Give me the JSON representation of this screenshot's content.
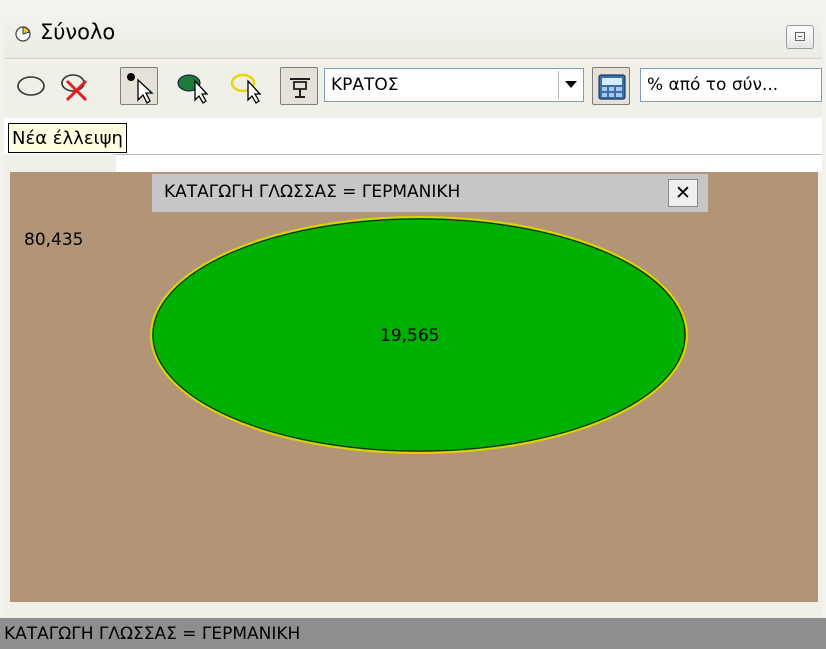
{
  "window": {
    "title": "Σύνολο",
    "icon": "pie-chart-icon"
  },
  "toolbar": {
    "buttons": [
      {
        "name": "ellipse-tool",
        "icon": "ellipse-icon",
        "pressed": false
      },
      {
        "name": "delete-ellipse",
        "icon": "delete-ellipse-icon",
        "pressed": false
      },
      {
        "name": "pointer-select",
        "icon": "pointer-select-icon",
        "pressed": true
      },
      {
        "name": "fill-select",
        "icon": "fill-select-icon",
        "pressed": false
      },
      {
        "name": "highlight-select",
        "icon": "highlight-select-icon",
        "pressed": false
      },
      {
        "name": "filter",
        "icon": "filter-icon",
        "pressed": true
      }
    ],
    "variable_select": "ΚΡΑΤΟΣ",
    "calculator_icon": "calculator-icon",
    "measure_select": "% από το σύν..."
  },
  "tooltip": {
    "text": "Νέα έλλειψη"
  },
  "canvas": {
    "background": "#b19576",
    "set_label": "ΚΑΤΑΓΩΓΗ ΓΛΩΣΣΑΣ = ΓΕΡΜΑΝΙΚΗ",
    "close_label": "✕",
    "outside_value": "80,435",
    "inside_value": "19,565",
    "ellipse_fill": "#00b000",
    "ellipse_stroke": "#e0d200"
  },
  "statusbar": {
    "text": "ΚΑΤΑΓΩΓΗ ΓΛΩΣΣΑΣ = ΓΕΡΜΑΝΙΚΗ"
  }
}
